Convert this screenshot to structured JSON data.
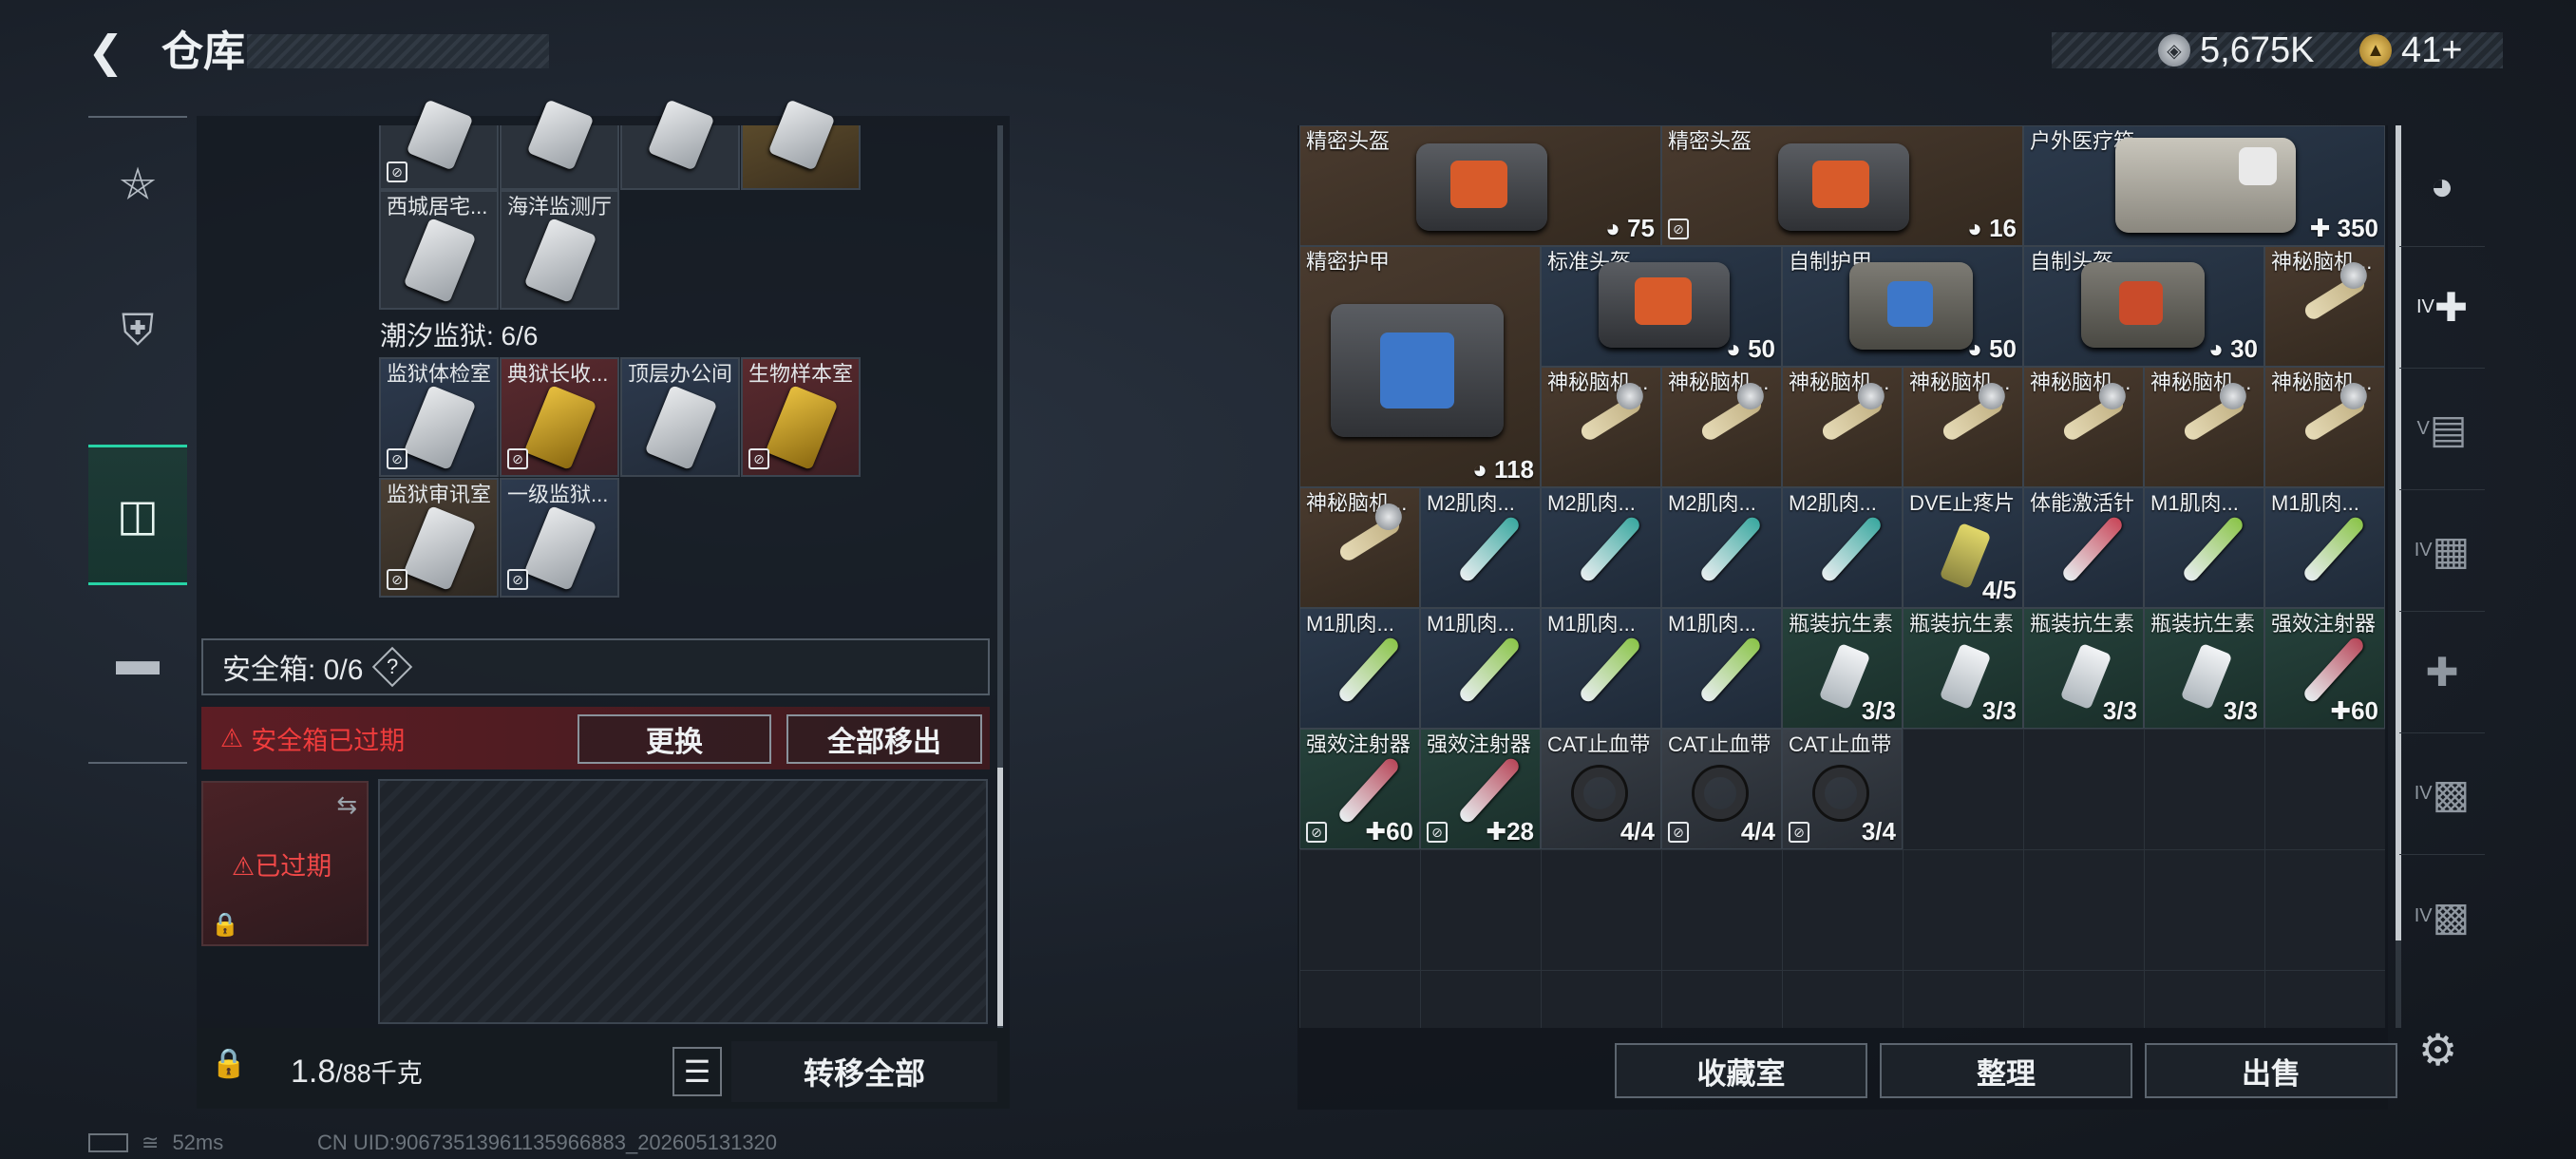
{
  "header": {
    "back_icon": "back-chevron-icon",
    "title": "仓库",
    "currency": [
      {
        "icon": "silver-coin-icon",
        "value": "5,675K",
        "color": "#b7bcc2"
      },
      {
        "icon": "gold-coin-icon",
        "value": "41+",
        "color": "#d8a63a"
      }
    ]
  },
  "left_nav": [
    {
      "icon": "pistol-icon"
    },
    {
      "icon": "armor-vest-icon"
    },
    {
      "icon": "backpack-icon",
      "active": true
    },
    {
      "icon": "briefcase-icon"
    }
  ],
  "keys": {
    "top_row_count": 4,
    "row2": [
      "西城居宅...",
      "海洋监测厅"
    ],
    "prison_label": "潮汐监狱: 6/6",
    "prison_row1": [
      "监狱体检室",
      "典狱长收...",
      "顶层办公间",
      "生物样本室"
    ],
    "prison_row2": [
      "监狱审讯室",
      "一级监狱..."
    ]
  },
  "safe_box": {
    "label": "安全箱: 0/6",
    "help": "?",
    "expired_warning": "安全箱已过期",
    "replace": "更换",
    "move_all": "全部移出",
    "slot_status": "已过期"
  },
  "footer_left": {
    "weight_value": "1.8",
    "weight_cap": "/88千克",
    "transfer_all": "转移全部"
  },
  "status": {
    "ping": "52ms",
    "uid": "CN UID:90673513961135966883_202605131320"
  },
  "inventory": {
    "items": [
      {
        "name": "精密头盔",
        "count": "75",
        "badge": "shield"
      },
      {
        "name": "精密头盔",
        "count": "16",
        "badge": "shield"
      },
      {
        "name": "户外医疗箱",
        "count": "350",
        "badge": "plus"
      },
      {
        "name": "精密护甲",
        "count": "118",
        "badge": "shield"
      },
      {
        "name": "标准头盔",
        "count": "50",
        "badge": "shield"
      },
      {
        "name": "自制护甲",
        "count": "50",
        "badge": "shield"
      },
      {
        "name": "自制头盔",
        "count": "30",
        "badge": "shield"
      },
      {
        "name": "神秘脑机...",
        "count": ""
      },
      {
        "name": "神秘脑机...",
        "count": ""
      },
      {
        "name": "神秘脑机...",
        "count": ""
      },
      {
        "name": "神秘脑机...",
        "count": ""
      },
      {
        "name": "神秘脑机...",
        "count": ""
      },
      {
        "name": "神秘脑机...",
        "count": ""
      },
      {
        "name": "神秘脑机...",
        "count": ""
      },
      {
        "name": "神秘脑机...",
        "count": ""
      },
      {
        "name": "神秘脑机...",
        "count": ""
      },
      {
        "name": "M2肌肉...",
        "count": ""
      },
      {
        "name": "M2肌肉...",
        "count": ""
      },
      {
        "name": "M2肌肉...",
        "count": ""
      },
      {
        "name": "M2肌肉...",
        "count": ""
      },
      {
        "name": "DVE止疼片",
        "count": "4/5"
      },
      {
        "name": "体能激活针",
        "count": ""
      },
      {
        "name": "M1肌肉...",
        "count": ""
      },
      {
        "name": "M1肌肉...",
        "count": ""
      },
      {
        "name": "M1肌肉...",
        "count": ""
      },
      {
        "name": "M1肌肉...",
        "count": ""
      },
      {
        "name": "M1肌肉...",
        "count": ""
      },
      {
        "name": "M1肌肉...",
        "count": ""
      },
      {
        "name": "瓶装抗生素",
        "count": "3/3"
      },
      {
        "name": "瓶装抗生素",
        "count": "3/3"
      },
      {
        "name": "瓶装抗生素",
        "count": "3/3"
      },
      {
        "name": "瓶装抗生素",
        "count": "3/3"
      },
      {
        "name": "强效注射器",
        "count": "60",
        "badge": "plus"
      },
      {
        "name": "强效注射器",
        "count": "60",
        "badge": "plus"
      },
      {
        "name": "强效注射器",
        "count": "28",
        "badge": "plus"
      },
      {
        "name": "CAT止血带",
        "count": "4/4"
      },
      {
        "name": "CAT止血带",
        "count": "4/4"
      },
      {
        "name": "CAT止血带",
        "count": "3/4"
      }
    ]
  },
  "footer_right": {
    "collection": "收藏室",
    "organize": "整理",
    "sell": "出售"
  },
  "right_nav": [
    {
      "icon": "helmet-icon"
    },
    {
      "icon": "medkit-iv-icon",
      "tier": "IV"
    },
    {
      "icon": "ammo-v-icon",
      "tier": "V"
    },
    {
      "icon": "cabinet-iv-icon",
      "tier": "IV"
    },
    {
      "icon": "medkit-plus-icon"
    },
    {
      "icon": "gear-box-iv-icon",
      "tier": "IV"
    },
    {
      "icon": "gear-box-iv-2-icon",
      "tier": "IV"
    }
  ]
}
